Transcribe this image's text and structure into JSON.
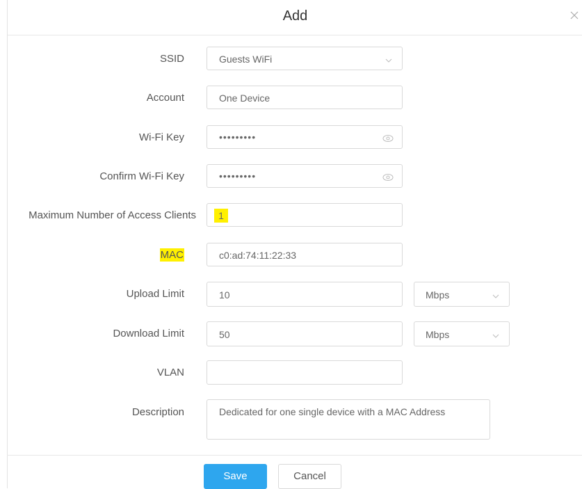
{
  "dialog": {
    "title": "Add",
    "close_label": "×"
  },
  "form": {
    "ssid": {
      "label": "SSID",
      "value": "Guests WiFi"
    },
    "account": {
      "label": "Account",
      "value": "One Device"
    },
    "wifi_key": {
      "label": "Wi-Fi Key",
      "value": "•••••••••"
    },
    "confirm_wifi_key": {
      "label": "Confirm Wi-Fi Key",
      "value": "•••••••••"
    },
    "max_clients": {
      "label": "Maximum Number of Access Clients",
      "value": "1"
    },
    "mac": {
      "label": "MAC",
      "value": "c0:ad:74:11:22:33"
    },
    "upload_limit": {
      "label": "Upload Limit",
      "value": "10",
      "unit": "Mbps"
    },
    "download_limit": {
      "label": "Download Limit",
      "value": "50",
      "unit": "Mbps"
    },
    "vlan": {
      "label": "VLAN",
      "value": ""
    },
    "description": {
      "label": "Description",
      "value": "Dedicated for one single device with a MAC Address"
    }
  },
  "buttons": {
    "save": "Save",
    "cancel": "Cancel"
  },
  "colors": {
    "primary": "#2ea6ee",
    "highlight": "#fff000"
  },
  "icons": {
    "close": "close-icon",
    "dropdown": "chevron-down-icon",
    "password_visibility": "eye-icon"
  }
}
